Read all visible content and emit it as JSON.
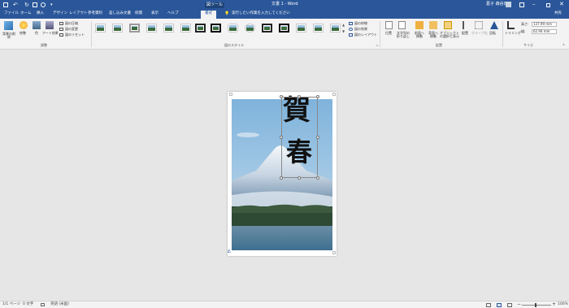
{
  "window": {
    "title": "文書 1 - Word",
    "context_tab": "図ツール",
    "user": "葛子 森谷田",
    "share": "共有"
  },
  "tabs": [
    "ファイル",
    "ホーム",
    "挿入",
    "デザイン",
    "レイアウト",
    "参考資料",
    "差し込み文書",
    "校閲",
    "表示",
    "ヘルプ",
    "書式"
  ],
  "tell_me": "実行したい作業を入力してください",
  "ribbon": {
    "adjust": {
      "remove_bg": "背景の削除",
      "corrections": "修整",
      "color": "色",
      "artistic": "アート効果",
      "compress": "図の圧縮",
      "change": "図の変更",
      "reset": "図のリセット",
      "group_label": "調整"
    },
    "styles": {
      "group_label": "図のスタイル",
      "border": "図の枠線",
      "effects": "図の効果",
      "layout": "図のレイアウト"
    },
    "arrange": {
      "position": "位置",
      "wrap": "文字列の折り返し",
      "forward": "前面へ移動",
      "backward": "背面へ移動",
      "selection": "オブジェクトの選択と表示",
      "align": "配置",
      "group": "グループ化",
      "rotate": "回転",
      "group_label": "配置"
    },
    "size": {
      "crop": "トリミング",
      "height_label": "高さ:",
      "height_value": "137.99 mm",
      "width_label": "幅:",
      "width_value": "62.94 mm",
      "group_label": "サイズ"
    }
  },
  "document": {
    "calligraphy": [
      "賀",
      "春"
    ]
  },
  "status": {
    "page": "1/1 ページ",
    "words": "0 文字",
    "lang": "英語 (米国)",
    "zoom": "100%"
  },
  "colors": {
    "accent": "#2b579a",
    "ribbon": "#f3f3f3",
    "canvas": "#e6e6e6"
  }
}
